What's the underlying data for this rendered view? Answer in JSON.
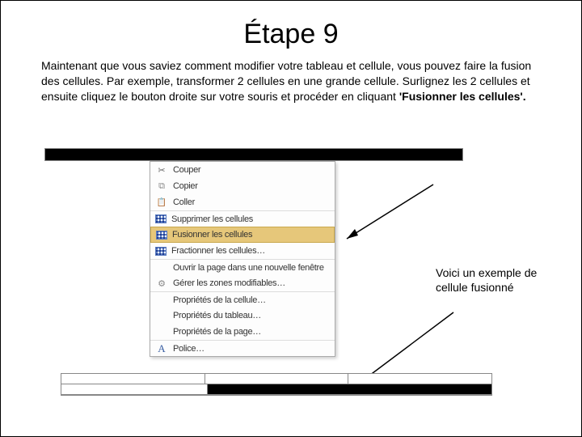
{
  "title": "Étape 9",
  "paragraph_part1": "Maintenant que vous saviez comment modifier votre tableau et cellule, vous pouvez faire la fusion des cellules. Par exemple, transformer 2 cellules en une grande cellule. Surlignez les 2 cellules et ensuite cliquez le bouton droite sur votre souris et procéder en cliquant ",
  "paragraph_bold": "'Fusionner les cellules'.",
  "menu": {
    "cut": "Couper",
    "copy": "Copier",
    "paste": "Coller",
    "delete_cells": "Supprimer les cellules",
    "merge_cells": "Fusionner les cellules",
    "split_cells": "Fractionner les cellules…",
    "open_new_window": "Ouvrir la page dans une nouvelle fenêtre",
    "manage_zones": "Gérer les zones modifiables…",
    "cell_props": "Propriétés de la cellule…",
    "table_props": "Propriétés du tableau…",
    "page_props": "Propriétés de la page…",
    "font": "Police…"
  },
  "caption": "Voici un exemple de cellule fusionné"
}
